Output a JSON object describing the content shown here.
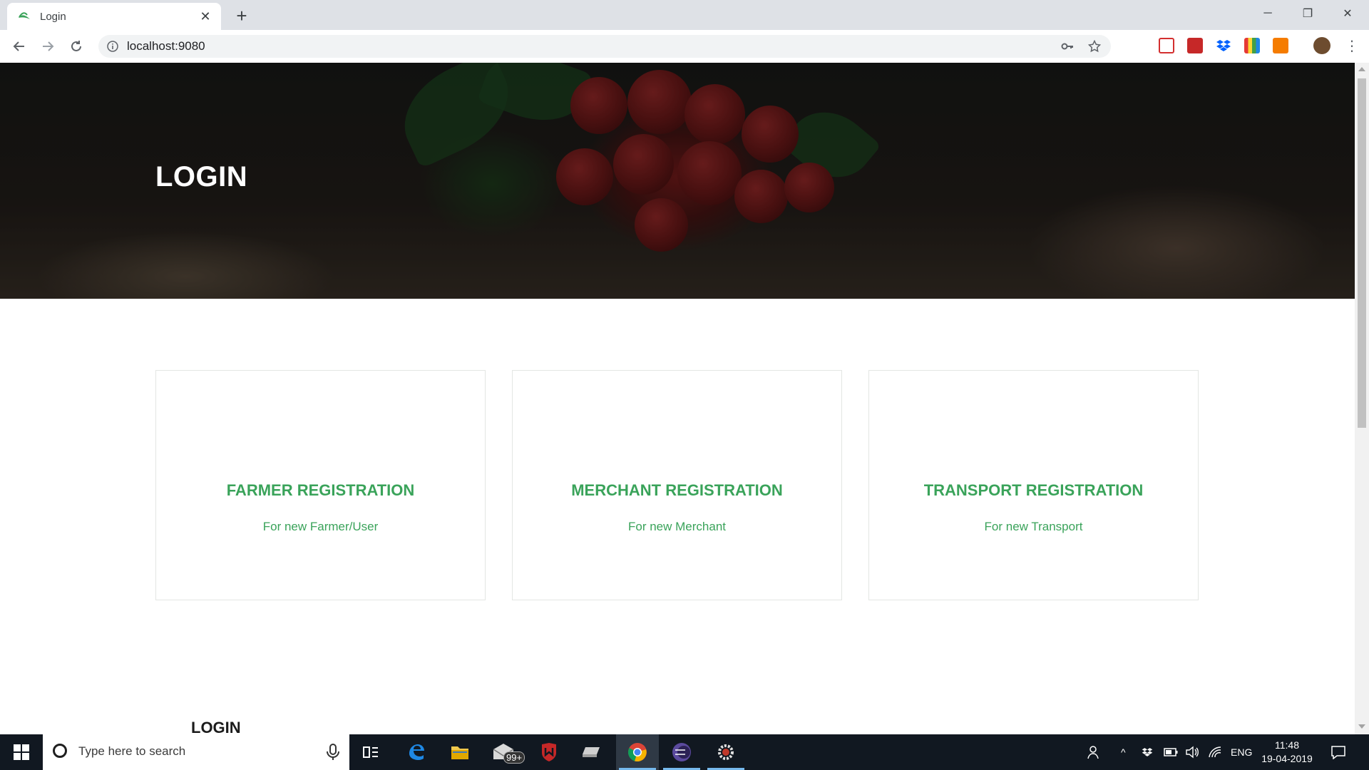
{
  "browser": {
    "tab_title": "Login",
    "url": "localhost:9080"
  },
  "page": {
    "hero_title": "LOGIN",
    "cards": [
      {
        "title": "FARMER REGISTRATION",
        "subtitle": "For new Farmer/User"
      },
      {
        "title": "MERCHANT REGISTRATION",
        "subtitle": "For new Merchant"
      },
      {
        "title": "TRANSPORT REGISTRATION",
        "subtitle": "For new Transport"
      }
    ],
    "section_title": "LOGIN"
  },
  "taskbar": {
    "search_placeholder": "Type here to search",
    "mail_badge": "99+",
    "language": "ENG",
    "time": "11:48",
    "date": "19-04-2019"
  },
  "colors": {
    "accent_green": "#3aa35a",
    "taskbar_bg": "#111821"
  }
}
